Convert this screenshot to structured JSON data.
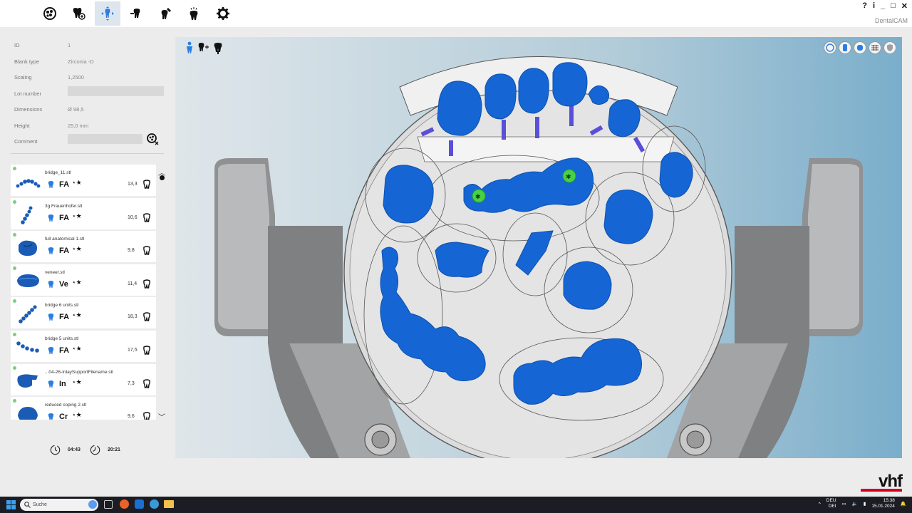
{
  "app": {
    "name": "DentalCAM",
    "win_controls": [
      "?",
      "i",
      "_",
      "□",
      "✕"
    ]
  },
  "toolbar": {
    "items": [
      {
        "name": "toolbar-jobs",
        "icon": "blank-disc-icon"
      },
      {
        "name": "toolbar-import",
        "icon": "tooth-import-icon"
      },
      {
        "name": "toolbar-nesting",
        "icon": "tooth-move-icon",
        "active": true
      },
      {
        "name": "toolbar-pins",
        "icon": "tooth-pin-icon"
      },
      {
        "name": "toolbar-calculate",
        "icon": "tooth-tool-icon"
      },
      {
        "name": "toolbar-mill",
        "icon": "tooth-spark-icon"
      },
      {
        "name": "toolbar-settings",
        "icon": "gear-icon"
      }
    ]
  },
  "properties": [
    {
      "label": "ID",
      "value": "1"
    },
    {
      "label": "Blank type",
      "value": "Zirconia -D"
    },
    {
      "label": "Scaling",
      "value": "1,2500"
    },
    {
      "label": "Lot number",
      "value": ""
    },
    {
      "label": "Dimensions",
      "value": "Ø 98,5"
    },
    {
      "label": "Height",
      "value": "25,0 mm"
    },
    {
      "label": "Comment",
      "value": ""
    }
  ],
  "jobs": [
    {
      "name": "bridge_11.stl",
      "type": "FA",
      "value": "13,3"
    },
    {
      "name": "3g.Frauenhofer.stl",
      "type": "FA",
      "value": "10,6"
    },
    {
      "name": "full anatomical 1.stl",
      "type": "FA",
      "value": "9,8"
    },
    {
      "name": "veneer.stl",
      "type": "Ve",
      "value": "11,4"
    },
    {
      "name": "bridge 6 units.stl",
      "type": "FA",
      "value": "18,3"
    },
    {
      "name": "bridge 5 units.stl",
      "type": "FA",
      "value": "17,5"
    },
    {
      "name": "...04-26-InlaySupportFilename.stl",
      "type": "In",
      "value": "7,3"
    },
    {
      "name": "reduced coping 2.stl",
      "type": "Cr",
      "value": "9,6"
    }
  ],
  "timers": {
    "elapsed": "04:43",
    "total": "20:21"
  },
  "brand": "vhf",
  "taskbar": {
    "search_placeholder": "Suche",
    "lang_top": "DEU",
    "lang_bottom": "DEI",
    "time": "15:38",
    "date": "15.01.2024"
  },
  "colors": {
    "tooth": "#1566d4",
    "accent": "#2a7de1",
    "brand_red": "#d4001e",
    "pin": "#5a4fd8",
    "marker": "#47d147"
  }
}
